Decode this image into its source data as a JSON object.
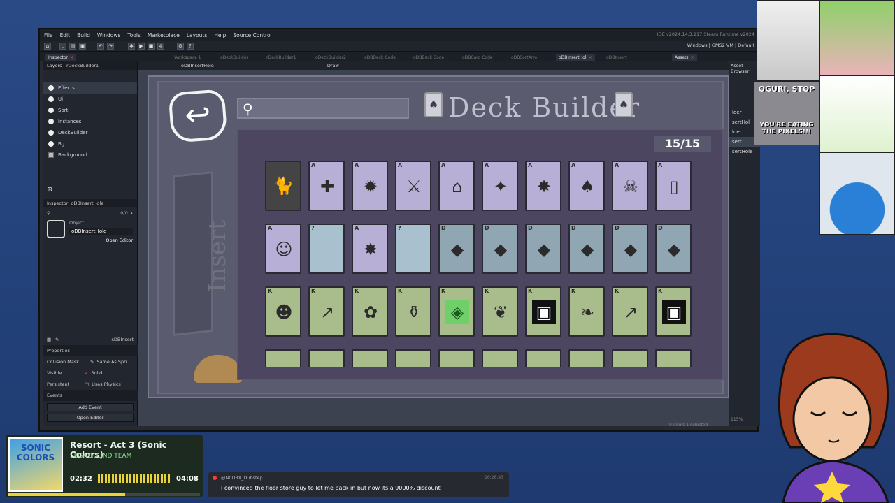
{
  "ide": {
    "menu": [
      "File",
      "Edit",
      "Build",
      "Windows",
      "Tools",
      "Marketplace",
      "Layouts",
      "Help",
      "Source Control"
    ],
    "version": "IDE v2024.14.3.217 Steam  Runtime v2024",
    "toolbar_right": "Windows | GMS2 VM | Default",
    "tabs": [
      {
        "label": "Inspector",
        "active": true
      },
      {
        "label": "Workspace 1",
        "active": false
      },
      {
        "label": "oDeckBuilder",
        "active": false
      },
      {
        "label": "rDeckBuilder1",
        "active": false
      },
      {
        "label": "oDeckBuilder2",
        "active": false
      },
      {
        "label": "oDBDeck Code",
        "active": false
      },
      {
        "label": "oDBBack Code",
        "active": false
      },
      {
        "label": "oDBCard Code",
        "active": false
      },
      {
        "label": "oDBSortArro",
        "active": false
      },
      {
        "label": "oDBInsertHol",
        "active": true
      },
      {
        "label": "oDBInsert",
        "active": false
      },
      {
        "label": "Assets",
        "active": true
      }
    ],
    "layers_title": "Layers - rDeckBuilder1",
    "layers": [
      {
        "label": "Effects",
        "icon": "circle",
        "selected": true
      },
      {
        "label": "Ui",
        "icon": "circle",
        "selected": false
      },
      {
        "label": "Sort",
        "icon": "circle",
        "selected": false
      },
      {
        "label": "Instances",
        "icon": "circle",
        "selected": false
      },
      {
        "label": "DeckBuilder",
        "icon": "circle",
        "selected": false
      },
      {
        "label": "Bg",
        "icon": "circle",
        "selected": false
      },
      {
        "label": "Background",
        "icon": "square",
        "selected": false
      }
    ],
    "inspector_title": "Inspector: oDBInsertHole",
    "inspector_count": "0/0",
    "object_label": "Object",
    "object_name": "oDBInsertHole",
    "open_editor": "Open Editor",
    "sprite_name": "sDBInsert",
    "properties_title": "Properties",
    "collision_mask": "Collision Mask",
    "same_as_sprite": "Same As Spri",
    "visible": "Visible",
    "solid": "Solid",
    "persistent": "Persistent",
    "uses_physics": "Uses Physics",
    "events_title": "Events",
    "add_event": "Add Event",
    "open_editor2": "Open Editor",
    "room_name": "oDBInsertHole",
    "draw_label": "Draw",
    "asset_browser": "Asset Browser",
    "right_list": [
      "lder",
      "sertHol",
      "lder",
      "sert",
      "sertHole"
    ],
    "status": "0 items   1 selected",
    "zoom": "115%"
  },
  "game": {
    "title": "Deck Builder",
    "counter": "15/15",
    "insert_label": "Insert",
    "rows": [
      [
        {
          "type": "photo",
          "rank": "",
          "icon": "cat-photo"
        },
        {
          "type": "A",
          "rank": "A",
          "icon": "plus"
        },
        {
          "type": "A",
          "rank": "A",
          "icon": "explosion"
        },
        {
          "type": "A",
          "rank": "A",
          "icon": "sword"
        },
        {
          "type": "A",
          "rank": "A",
          "icon": "bread"
        },
        {
          "type": "A",
          "rank": "A",
          "icon": "fighter"
        },
        {
          "type": "A",
          "rank": "A",
          "icon": "pow"
        },
        {
          "type": "A",
          "rank": "A",
          "icon": "spade"
        },
        {
          "type": "A",
          "rank": "A",
          "icon": "skull"
        },
        {
          "type": "A",
          "rank": "A",
          "icon": "card"
        }
      ],
      [
        {
          "type": "A",
          "rank": "A",
          "icon": "ghost"
        },
        {
          "type": "Q",
          "rank": "?",
          "icon": "blank"
        },
        {
          "type": "A",
          "rank": "A",
          "icon": "pow"
        },
        {
          "type": "Q",
          "rank": "?",
          "icon": "blank"
        },
        {
          "type": "D",
          "rank": "D",
          "icon": "diamond"
        },
        {
          "type": "D",
          "rank": "D",
          "icon": "diamond"
        },
        {
          "type": "D",
          "rank": "D",
          "icon": "diamond"
        },
        {
          "type": "D",
          "rank": "D",
          "icon": "diamond"
        },
        {
          "type": "D",
          "rank": "D",
          "icon": "diamond"
        },
        {
          "type": "D",
          "rank": "D",
          "icon": "diamond"
        }
      ],
      [
        {
          "type": "K",
          "rank": "K",
          "icon": "face"
        },
        {
          "type": "K",
          "rank": "K",
          "icon": "arrow"
        },
        {
          "type": "K",
          "rank": "K",
          "icon": "plant"
        },
        {
          "type": "K",
          "rank": "K",
          "icon": "jar"
        },
        {
          "type": "K",
          "rank": "K",
          "icon": "gem"
        },
        {
          "type": "K",
          "rank": "K",
          "icon": "leaves"
        },
        {
          "type": "K",
          "rank": "K",
          "icon": "tv"
        },
        {
          "type": "K",
          "rank": "K",
          "icon": "blob"
        },
        {
          "type": "K",
          "rank": "K",
          "icon": "arrow"
        },
        {
          "type": "K",
          "rank": "K",
          "icon": "tv"
        }
      ]
    ]
  },
  "overlay": {
    "song": "Resort - Act 3 (Sonic Colors)",
    "artist": "SEGA SOUND TEAM",
    "album_text": "SONIC COLORS",
    "time_now": "02:32",
    "time_total": "04:08",
    "progress": 0.61,
    "chat_user": "@N0D3X_Dubstep",
    "chat_time": "16:26:43",
    "chat_msg": "I convinced the floor store guy to let me back in but now its a 9000% discount",
    "meme_text_top": "OGURI, STOP",
    "meme_text_bottom": "YOU'RE EATING THE PIXELS!!!"
  },
  "colors": {
    "accent_pink": "#ff4a7a",
    "progress_yellow": "#e9d23a",
    "artist_green": "#8ee08c"
  }
}
